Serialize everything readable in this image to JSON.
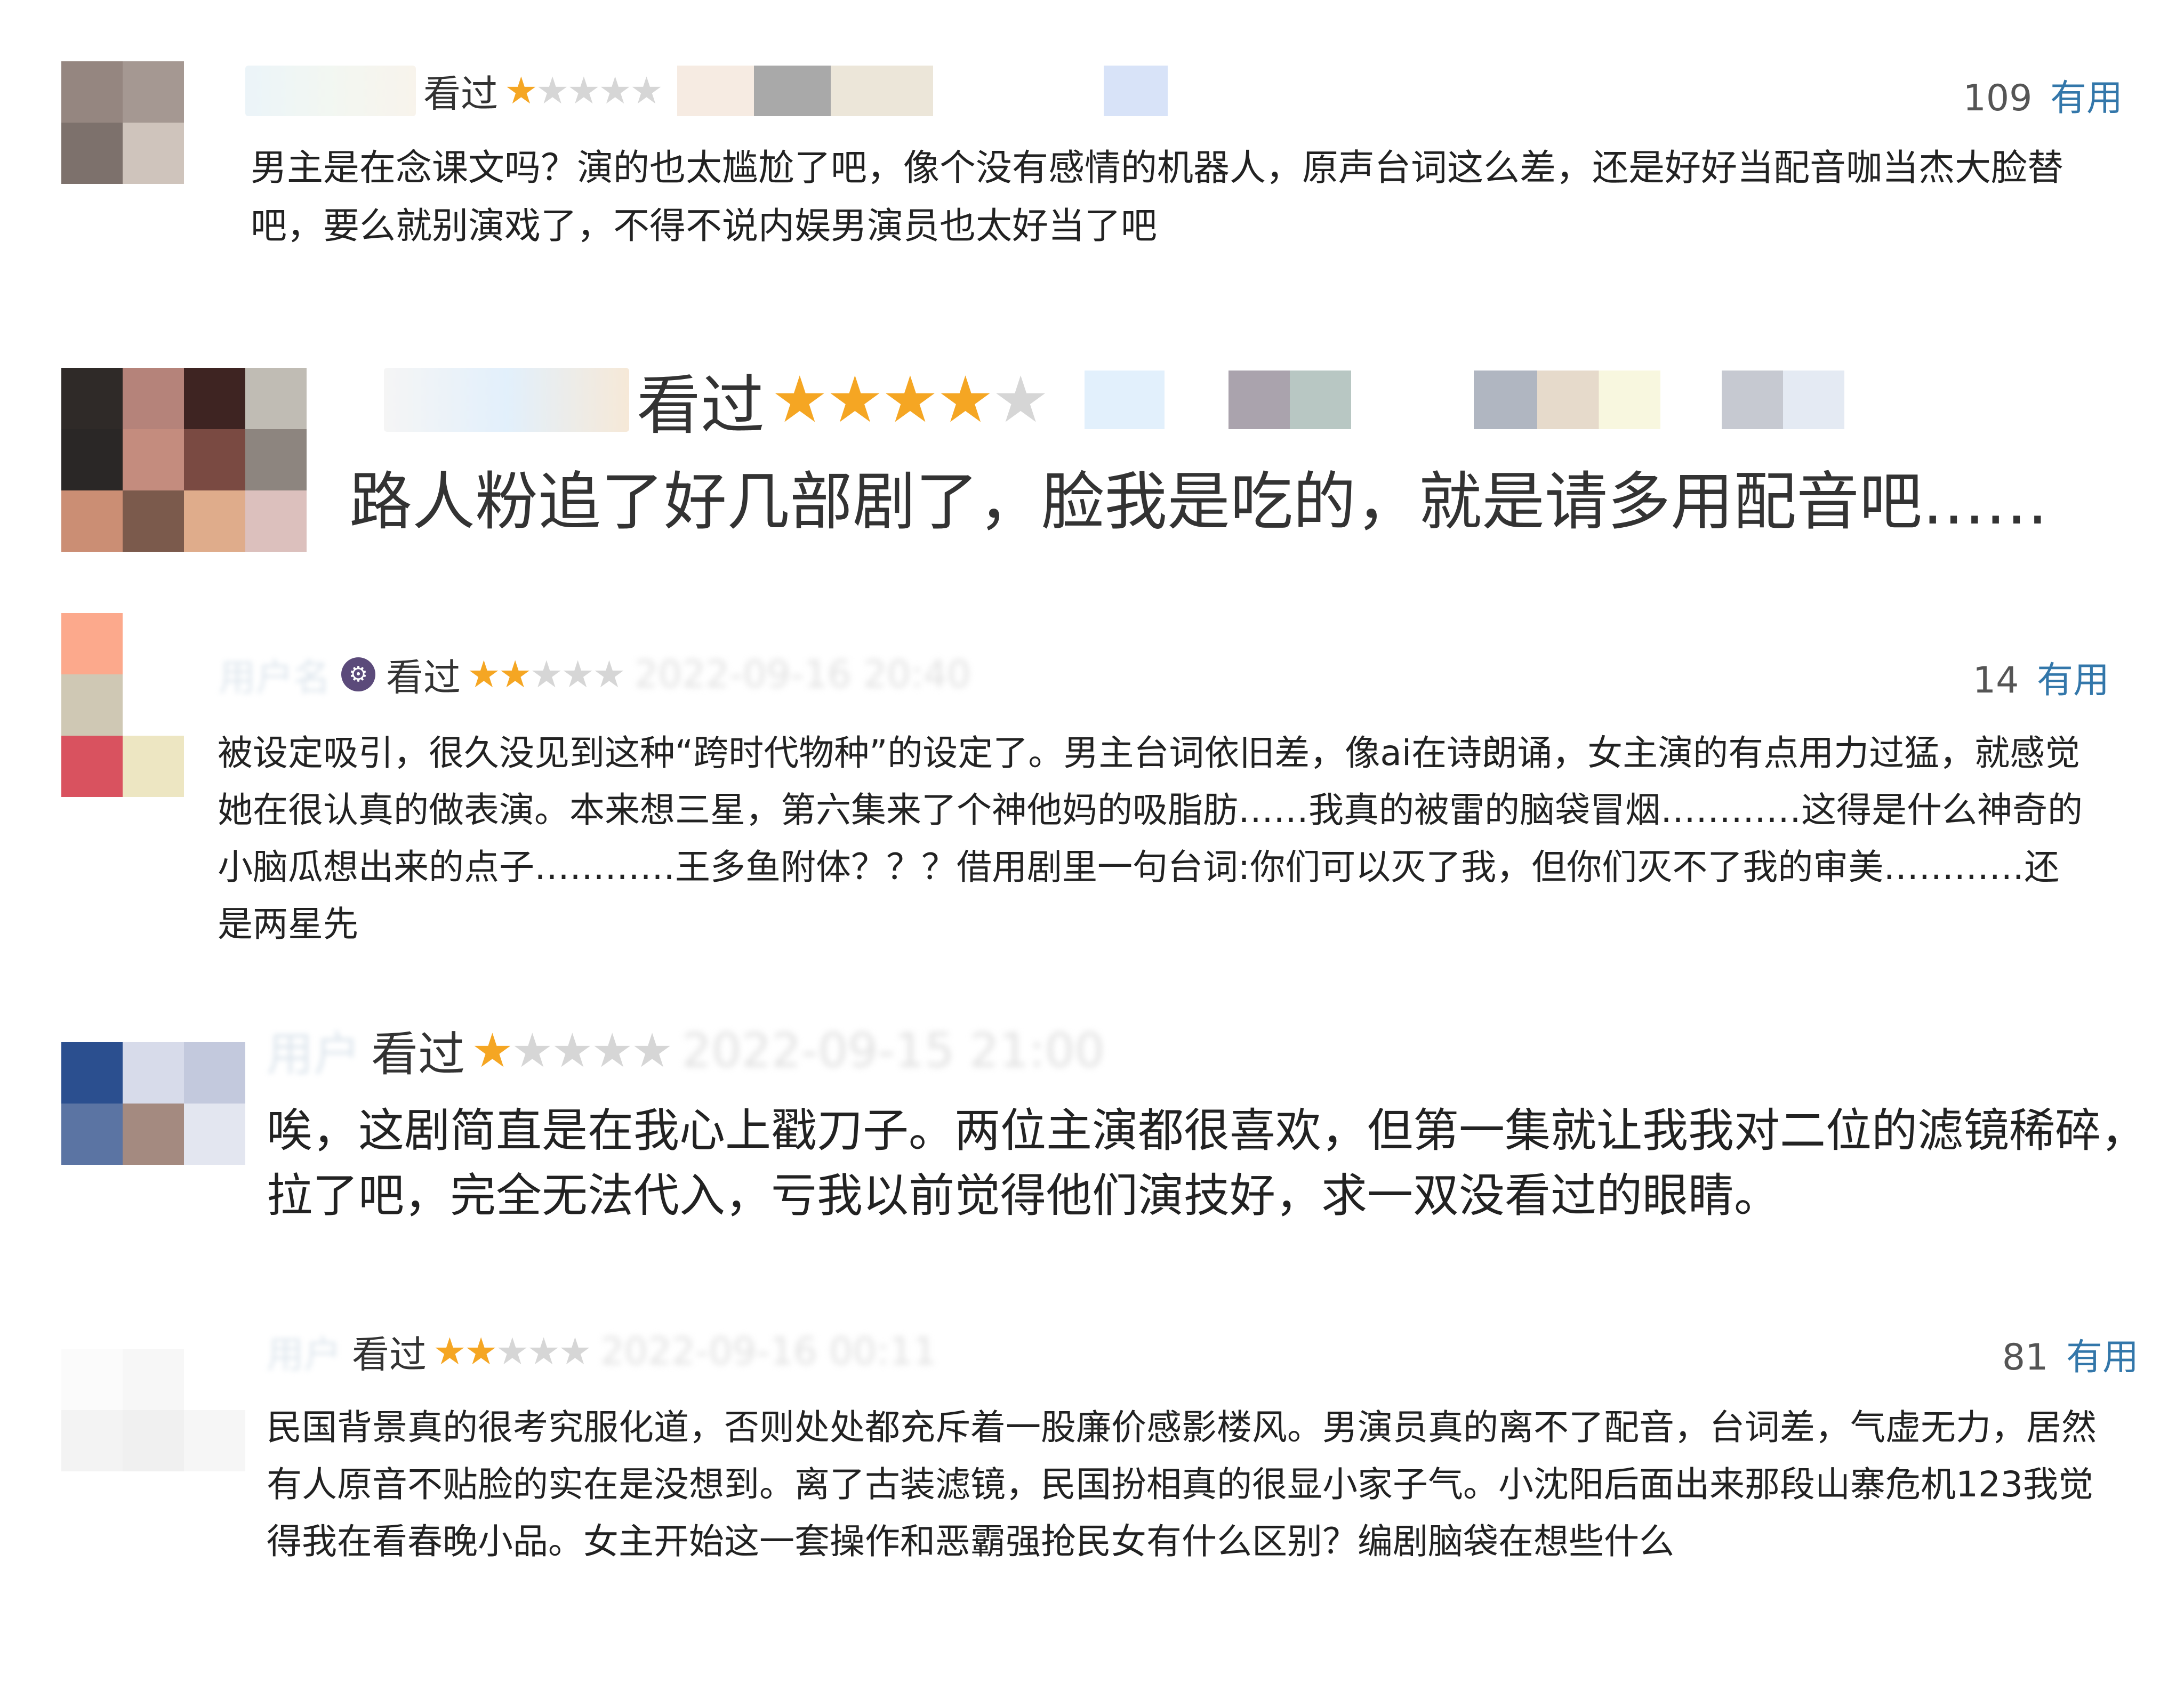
{
  "colors": {
    "star_on": "#f5a623",
    "star_off": "#d6d6d6",
    "helpful_link": "#3377aa",
    "text": "#222222"
  },
  "reviews": [
    {
      "status": "看过",
      "rating": 1,
      "votes": "109",
      "helpful_label": "有用",
      "content": "男主是在念课文吗？演的也太尴尬了吧，像个没有感情的机器人，原声台词这么差，还是好好当配音咖当杰大脸替吧，要么就别演戏了，不得不说内娱男演员也太好当了吧"
    },
    {
      "status": "看过",
      "rating": 4,
      "content": "路人粉追了好几部剧了，脸我是吃的，就是请多用配音吧……"
    },
    {
      "status": "看过",
      "rating": 2,
      "votes": "14",
      "helpful_label": "有用",
      "badge_icon": "robot-icon",
      "content": "被设定吸引，很久没见到这种“跨时代物种”的设定了。男主台词依旧差，像ai在诗朗诵，女主演的有点用力过猛，就感觉她在很认真的做表演。本来想三星，第六集来了个神他妈的吸脂肪……我真的被雷的脑袋冒烟…………这得是什么神奇的小脑瓜想出来的点子…………王多鱼附体？？？借用剧里一句台词:你们可以灭了我，但你们灭不了我的审美…………还是两星先"
    },
    {
      "status": "看过",
      "rating": 1,
      "content": "唉，这剧简直是在我心上戳刀子。两位主演都很喜欢，但第一集就让我我对二位的滤镜稀碎，拉了吧，完全无法代入，亏我以前觉得他们演技好，求一双没看过的眼睛。"
    },
    {
      "status": "看过",
      "rating": 2,
      "votes": "81",
      "helpful_label": "有用",
      "content": "民国背景真的很考究服化道，否则处处都充斥着一股廉价感影楼风。男演员真的离不了配音，台词差，气虚无力，居然有人原音不贴脸的实在是没想到。离了古装滤镜，民国扮相真的很显小家子气。小沈阳后面出来那段山寨危机123我觉得我在看春晚小品。女主开始这一套操作和恶霸强抢民女有什么区别？编剧脑袋在想些什么"
    }
  ]
}
